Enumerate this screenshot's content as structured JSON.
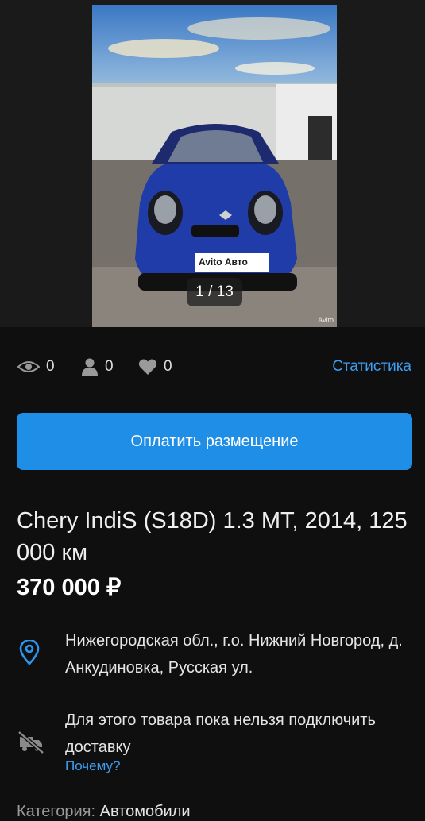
{
  "gallery": {
    "counter": "1 / 13",
    "plate_text": "Avito Авто",
    "watermark": "Avito"
  },
  "stats": {
    "views": "0",
    "contacts": "0",
    "favorites": "0",
    "link": "Статистика"
  },
  "pay_button": "Оплатить размещение",
  "listing": {
    "title": "Chery IndiS (S18D) 1.3 MT, 2014, 125 000 км",
    "price": "370 000 ₽",
    "address": "Нижегородская обл., г.о. Нижний Новгород, д. Анкудиновка, Русская ул.",
    "delivery_text": "Для этого товара пока нельзя подключить доставку",
    "delivery_why": "Почему?",
    "category_label": "Категория:",
    "category_value": "Автомобили"
  },
  "colors": {
    "background": "#0f0f0f",
    "accent": "#1e8ee6",
    "link": "#3d9df2"
  },
  "icons": [
    "eye-icon",
    "person-icon",
    "heart-icon",
    "location-pin-icon",
    "no-delivery-icon"
  ]
}
